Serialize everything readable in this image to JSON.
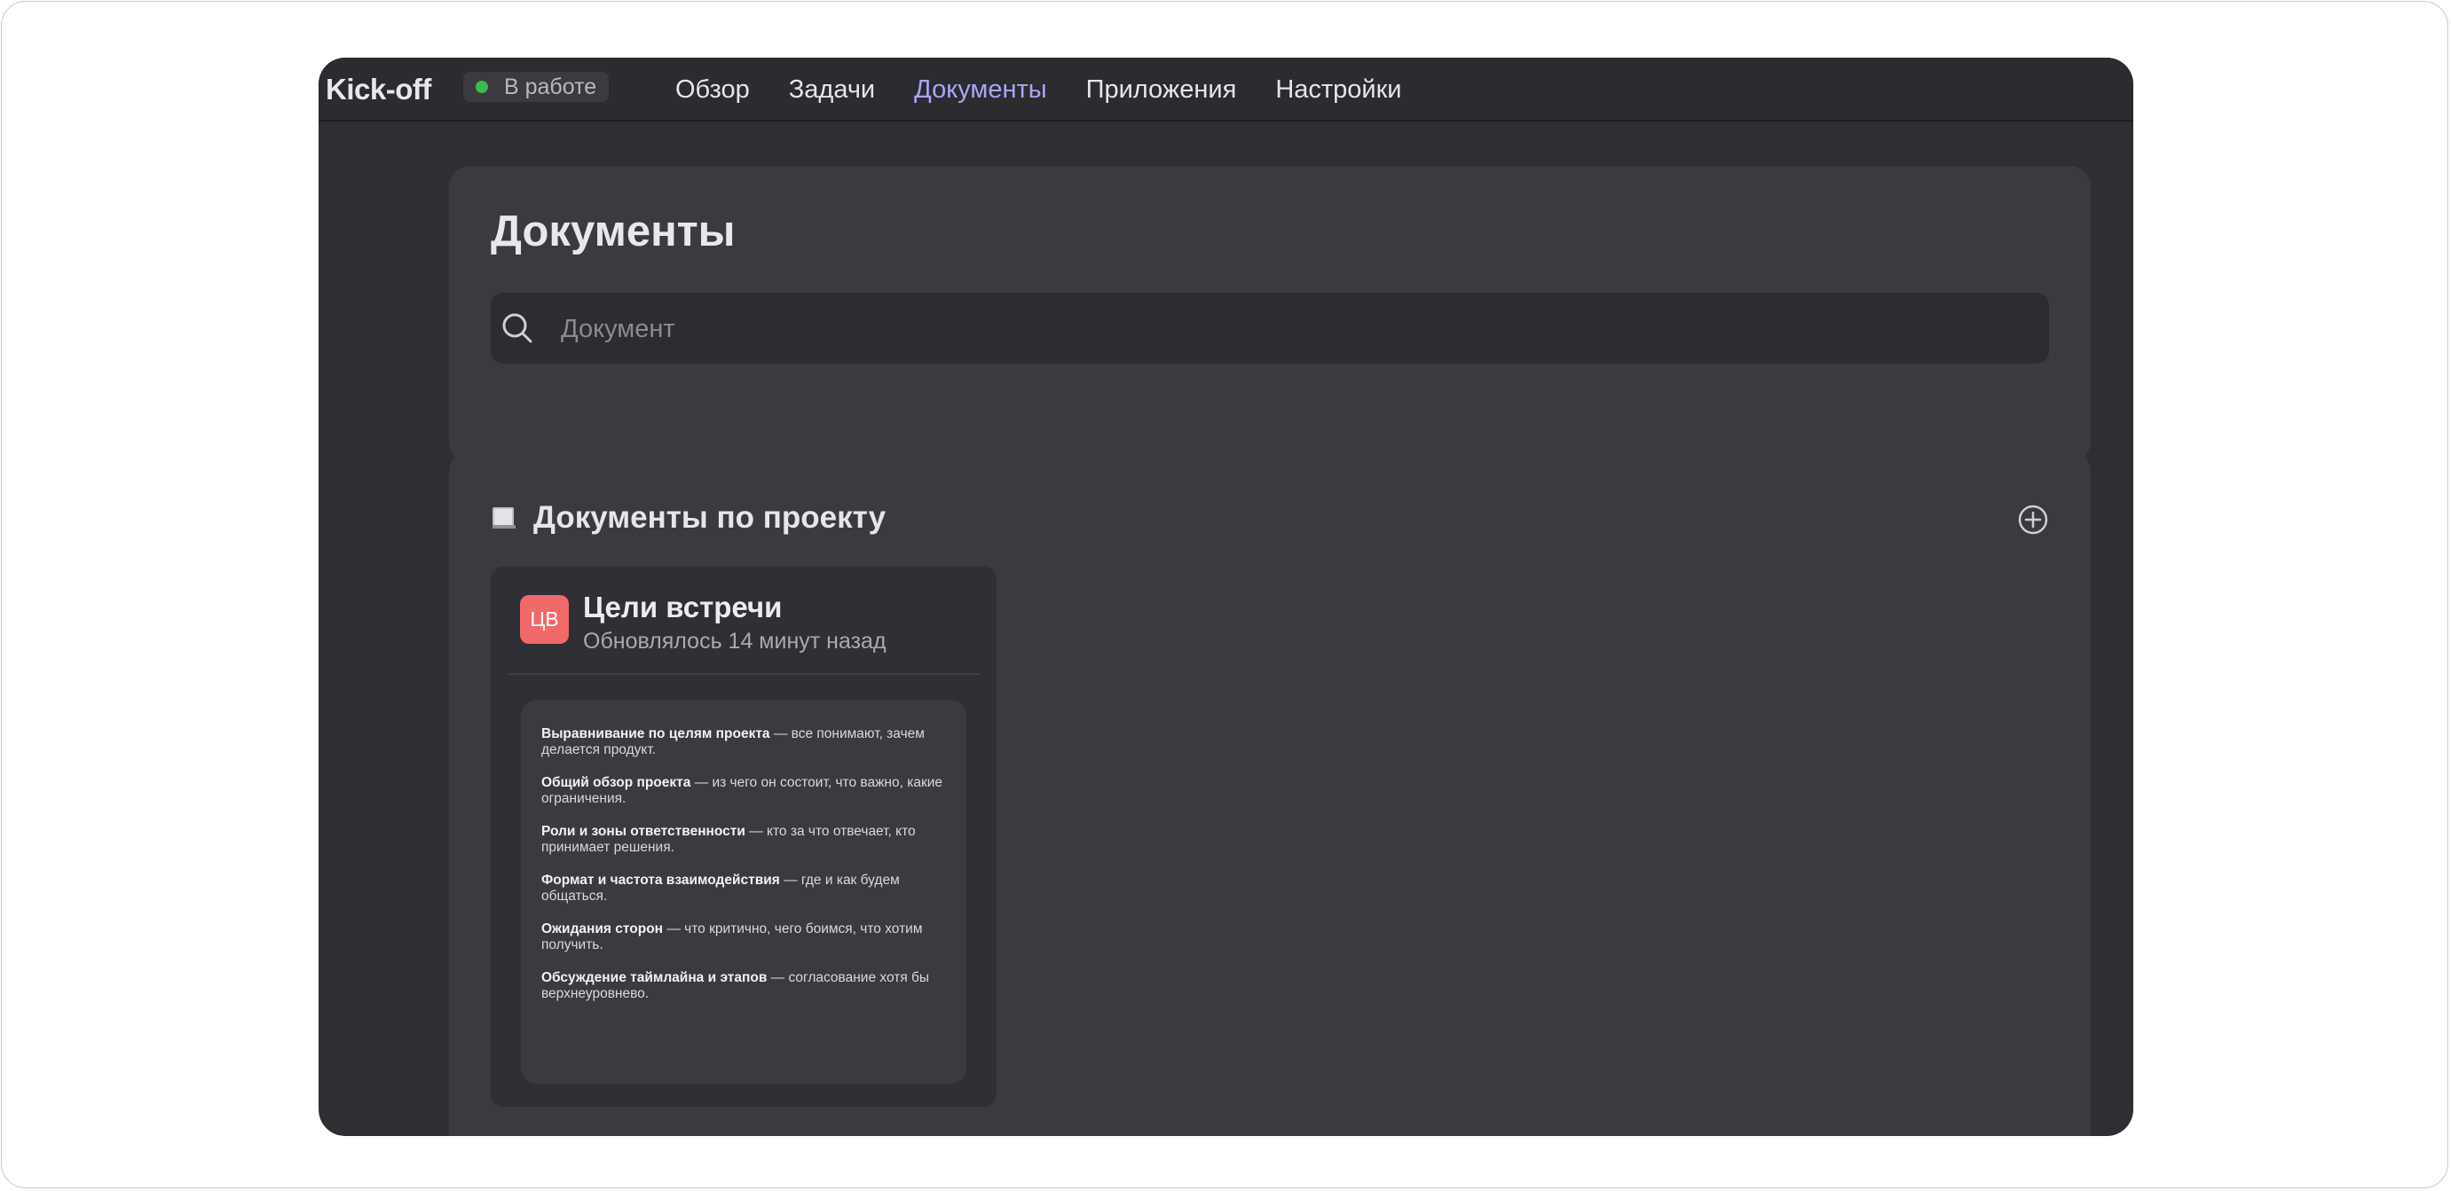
{
  "app": {
    "title": "Kick-off",
    "status": "В работе",
    "status_color": "#3dba4e",
    "accent": "#a9a6f5"
  },
  "nav": {
    "tabs": [
      {
        "label": "Обзор",
        "active": false
      },
      {
        "label": "Задачи",
        "active": false
      },
      {
        "label": "Документы",
        "active": true
      },
      {
        "label": "Приложения",
        "active": false
      },
      {
        "label": "Настройки",
        "active": false
      }
    ]
  },
  "page": {
    "title": "Документы",
    "search_placeholder": "Документ",
    "search_value": "",
    "search_icon": "search-icon"
  },
  "section": {
    "icon": "book-icon",
    "title": "Документы по проекту",
    "add_icon": "plus-circle-icon"
  },
  "documents": [
    {
      "initials": "ЦВ",
      "avatar_color": "#f06a6a",
      "title": "Цели встречи",
      "updated": "Обновлялось 14 минут назад",
      "preview": [
        {
          "bold": "Выравнивание по целям проекта",
          "text": " — все понимают, зачем делается продукт."
        },
        {
          "bold": "Общий обзор проекта",
          "text": " — из чего он состоит, что важно, какие ограничения."
        },
        {
          "bold": "Роли и зоны ответственности",
          "text": " — кто за что отвечает, кто принимает решения."
        },
        {
          "bold": "Формат и частота взаимодействия",
          "text": " — где и как будем общаться."
        },
        {
          "bold": "Ожидания сторон",
          "text": " — что критично, чего боимся, что хотим получить."
        },
        {
          "bold": "Обсуждение таймлайна и этапов",
          "text": " — согласование хотя бы верхнеуровнево."
        }
      ]
    }
  ]
}
